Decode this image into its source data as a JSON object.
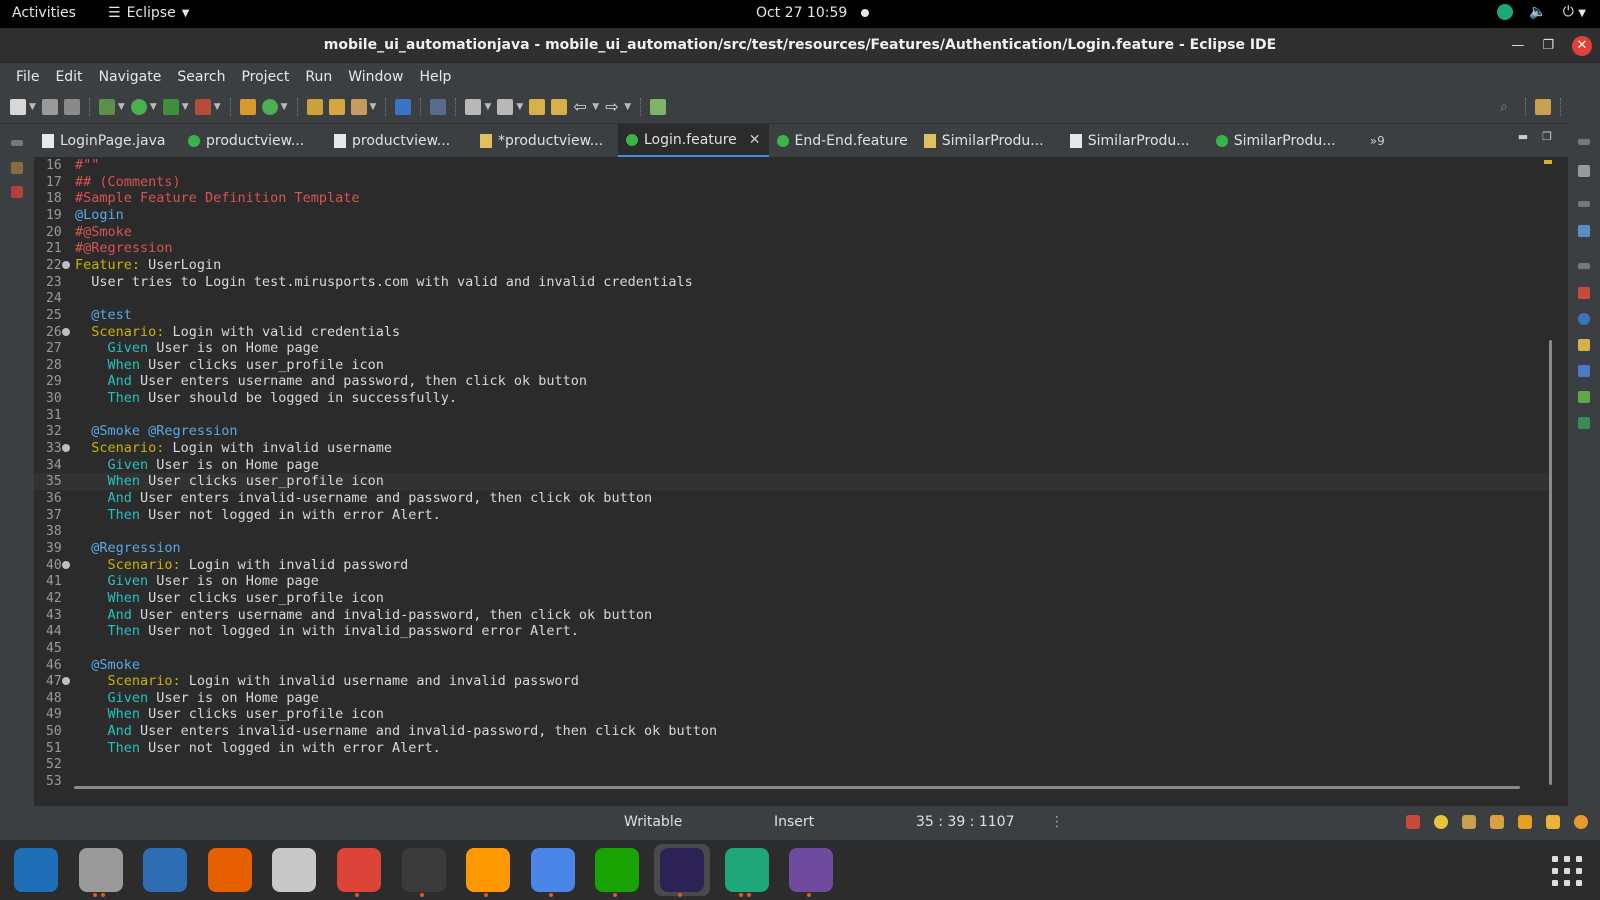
{
  "topbar": {
    "activities": "Activities",
    "app_menu": "Eclipse",
    "clock": "Oct 27  10:59"
  },
  "window": {
    "title": "mobile_ui_automationjava - mobile_ui_automation/src/test/resources/Features/Authentication/Login.feature - Eclipse IDE"
  },
  "menu": [
    "File",
    "Edit",
    "Navigate",
    "Search",
    "Project",
    "Run",
    "Window",
    "Help"
  ],
  "tabs": [
    {
      "label": "LoginPage.java",
      "icon": "java-file-icon",
      "active": false
    },
    {
      "label": "productview...",
      "icon": "cucumber-file-icon",
      "active": false
    },
    {
      "label": "productview...",
      "icon": "java-file-icon",
      "active": false
    },
    {
      "label": "*productview...",
      "icon": "java-file-icon",
      "active": false
    },
    {
      "label": "Login.feature",
      "icon": "cucumber-file-icon",
      "active": true
    },
    {
      "label": "End-End.feature",
      "icon": "cucumber-file-icon",
      "active": false
    },
    {
      "label": "SimilarProdu...",
      "icon": "java-file-icon",
      "active": false
    },
    {
      "label": "SimilarProdu...",
      "icon": "java-file-icon",
      "active": false
    },
    {
      "label": "SimilarProdu...",
      "icon": "cucumber-file-icon",
      "active": false
    }
  ],
  "tab_overflow": "»9",
  "editor": {
    "current_line": 35,
    "lines": [
      {
        "n": "16",
        "t": "#\"\"",
        "c": "red"
      },
      {
        "n": "17",
        "t": "## (Comments)",
        "c": "red"
      },
      {
        "n": "18",
        "t": "#Sample Feature Definition Template",
        "c": "red"
      },
      {
        "n": "19",
        "t": "@Login",
        "c": "tag"
      },
      {
        "n": "20",
        "t": "#@Smoke",
        "c": "red"
      },
      {
        "n": "21",
        "t": "#@Regression",
        "c": "red"
      },
      {
        "n": "22",
        "fold": true,
        "kw": "Feature:",
        "t": " UserLogin",
        "indent": ""
      },
      {
        "n": "23",
        "t": "  User tries to Login test.mirusports.com with valid and invalid credentials",
        "c": "plain"
      },
      {
        "n": "24",
        "t": "",
        "c": "plain"
      },
      {
        "n": "25",
        "t": "  @test",
        "c": "tag"
      },
      {
        "n": "26",
        "fold": true,
        "kw": "Scenario:",
        "t": " Login with valid credentials",
        "indent": "  "
      },
      {
        "n": "27",
        "step": "Given",
        "t": " User is on Home page",
        "indent": "    "
      },
      {
        "n": "28",
        "step": "When",
        "t": " User clicks user_profile icon",
        "indent": "    "
      },
      {
        "n": "29",
        "step": "And",
        "t": " User enters username and password, then click ok button",
        "indent": "    "
      },
      {
        "n": "30",
        "step": "Then",
        "t": " User should be logged in successfully.",
        "indent": "    "
      },
      {
        "n": "31",
        "t": "",
        "c": "plain"
      },
      {
        "n": "32",
        "t": "  @Smoke @Regression",
        "c": "tag"
      },
      {
        "n": "33",
        "fold": true,
        "kw": "Scenario:",
        "t": " Login with invalid username",
        "indent": "  "
      },
      {
        "n": "34",
        "step": "Given",
        "t": " User is on Home page",
        "indent": "    "
      },
      {
        "n": "35",
        "step": "When",
        "t": " User clicks user_profile icon",
        "indent": "    "
      },
      {
        "n": "36",
        "step": "And",
        "t": " User enters invalid-username and password, then click ok button",
        "indent": "    "
      },
      {
        "n": "37",
        "step": "Then",
        "t": " User not logged in with error Alert.",
        "indent": "    "
      },
      {
        "n": "38",
        "t": "",
        "c": "plain"
      },
      {
        "n": "39",
        "t": "  @Regression",
        "c": "tag"
      },
      {
        "n": "40",
        "fold": true,
        "kw": "Scenario:",
        "t": " Login with invalid password",
        "indent": "    "
      },
      {
        "n": "41",
        "step": "Given",
        "t": " User is on Home page",
        "indent": "    "
      },
      {
        "n": "42",
        "step": "When",
        "t": " User clicks user_profile icon",
        "indent": "    "
      },
      {
        "n": "43",
        "step": "And",
        "t": " User enters username and invalid-password, then click ok button",
        "indent": "    "
      },
      {
        "n": "44",
        "step": "Then",
        "t": " User not logged in with invalid_password error Alert.",
        "indent": "    "
      },
      {
        "n": "45",
        "t": "",
        "c": "plain"
      },
      {
        "n": "46",
        "t": "  @Smoke",
        "c": "tag"
      },
      {
        "n": "47",
        "fold": true,
        "kw": "Scenario:",
        "t": " Login with invalid username and invalid password",
        "indent": "    "
      },
      {
        "n": "48",
        "step": "Given",
        "t": " User is on Home page",
        "indent": "    "
      },
      {
        "n": "49",
        "step": "When",
        "t": " User clicks user_profile icon",
        "indent": "    "
      },
      {
        "n": "50",
        "step": "And",
        "t": " User enters invalid-username and invalid-password, then click ok button",
        "indent": "    "
      },
      {
        "n": "51",
        "step": "Then",
        "t": " User not logged in with error Alert.",
        "indent": "    "
      },
      {
        "n": "52",
        "t": "",
        "c": "plain"
      },
      {
        "n": "53",
        "t": "",
        "c": "plain"
      }
    ]
  },
  "status": {
    "writable": "Writable",
    "insert_mode": "Insert",
    "position": "35 : 39 : 1107"
  },
  "dock": [
    {
      "name": "libreoffice-writer-icon",
      "color": "#1e6fb8"
    },
    {
      "name": "files-icon",
      "color": "#9a9a9a",
      "dots": 2
    },
    {
      "name": "thunderbird-icon",
      "color": "#2e6db4"
    },
    {
      "name": "firefox-icon",
      "color": "#e66000"
    },
    {
      "name": "image-viewer-icon",
      "color": "#c8c8c8"
    },
    {
      "name": "chrome-icon",
      "color": "#db4437",
      "dots": 1
    },
    {
      "name": "terminal-icon",
      "color": "#3a3a3a",
      "dots": 1
    },
    {
      "name": "sublime-text-icon",
      "color": "#ff9800",
      "dots": 1
    },
    {
      "name": "text-editor-icon",
      "color": "#4a86e8",
      "dots": 1
    },
    {
      "name": "libreoffice-calc-icon",
      "color": "#18a303",
      "dots": 1
    },
    {
      "name": "eclipse-icon",
      "color": "#2c2255",
      "dots": 1,
      "active": true
    },
    {
      "name": "xmind-icon",
      "color": "#1fa77a",
      "dots": 2
    },
    {
      "name": "github-desktop-icon",
      "color": "#6e4b9e",
      "dots": 1
    }
  ],
  "colors": {
    "accent": "#3d8edb",
    "comment_red": "#d9534f",
    "tag_blue": "#5aa9e6",
    "keyword_yellow": "#c8b400",
    "step_cyan": "#27c0c0",
    "ubuntu_orange": "#e95420"
  }
}
